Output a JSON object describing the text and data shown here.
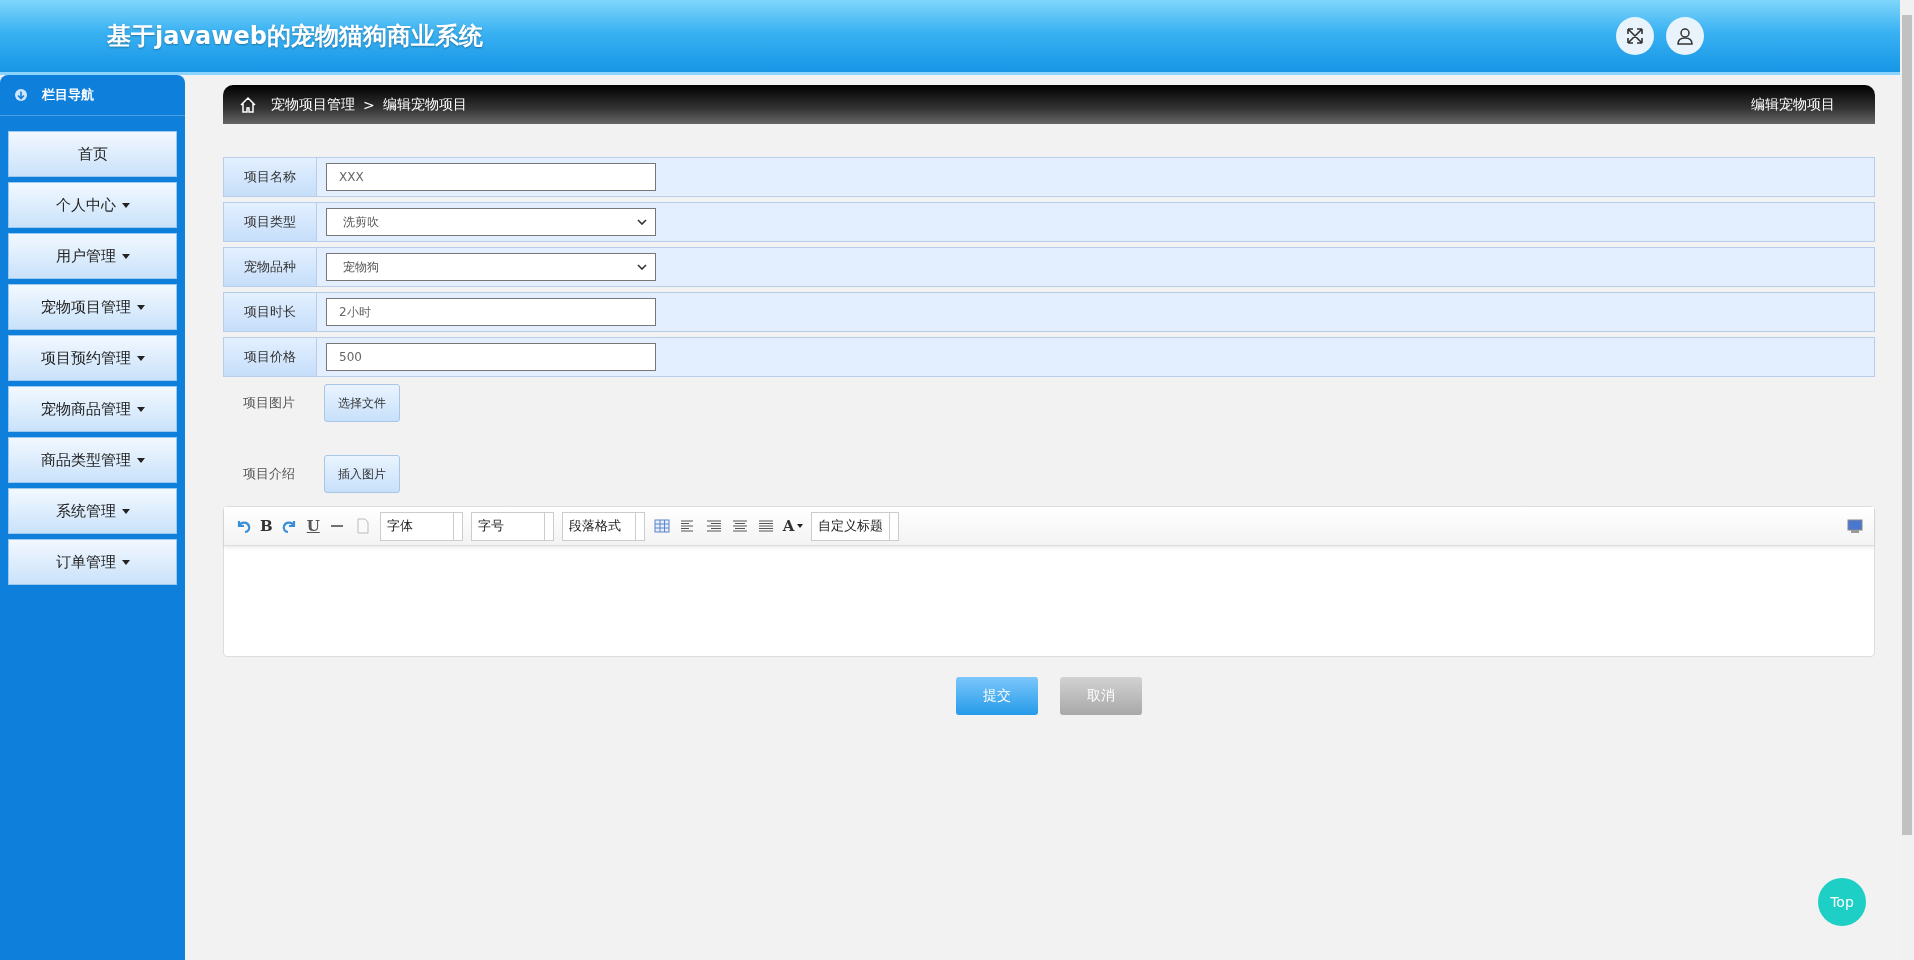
{
  "header": {
    "title": "基于javaweb的宠物猫狗商业系统"
  },
  "sidebar": {
    "title": "栏目导航",
    "items": [
      {
        "label": "首页",
        "has_menu": false
      },
      {
        "label": "个人中心",
        "has_menu": true
      },
      {
        "label": "用户管理",
        "has_menu": true
      },
      {
        "label": "宠物项目管理",
        "has_menu": true
      },
      {
        "label": "项目预约管理",
        "has_menu": true
      },
      {
        "label": "宠物商品管理",
        "has_menu": true
      },
      {
        "label": "商品类型管理",
        "has_menu": true
      },
      {
        "label": "系统管理",
        "has_menu": true
      },
      {
        "label": "订单管理",
        "has_menu": true
      }
    ]
  },
  "breadcrumb": {
    "items": [
      "宠物项目管理",
      "编辑宠物项目"
    ],
    "separator": ">",
    "page_title": "编辑宠物项目"
  },
  "form": {
    "fields": [
      {
        "kind": "text",
        "label": "项目名称",
        "value": "XXX"
      },
      {
        "kind": "select",
        "label": "项目类型",
        "value": "洗剪吹"
      },
      {
        "kind": "select",
        "label": "宠物品种",
        "value": "宠物狗"
      },
      {
        "kind": "text",
        "label": "项目时长",
        "value": "2小时"
      },
      {
        "kind": "text",
        "label": "项目价格",
        "value": "500"
      },
      {
        "kind": "file",
        "label": "项目图片",
        "button": "选择文件"
      },
      {
        "kind": "rich",
        "label": "项目介绍",
        "button": "插入图片"
      }
    ]
  },
  "editor": {
    "toolbar": [
      {
        "kind": "undo"
      },
      {
        "kind": "bold",
        "text": "B"
      },
      {
        "kind": "redo"
      },
      {
        "kind": "underline",
        "text": "U"
      },
      {
        "kind": "hr"
      },
      {
        "kind": "page"
      },
      {
        "kind": "select",
        "text": "字体"
      },
      {
        "kind": "select",
        "text": "字号"
      },
      {
        "kind": "select",
        "text": "段落格式"
      },
      {
        "kind": "table"
      },
      {
        "kind": "align-left"
      },
      {
        "kind": "align-right"
      },
      {
        "kind": "align-center"
      },
      {
        "kind": "justify"
      },
      {
        "kind": "font-color",
        "text": "A"
      },
      {
        "kind": "select",
        "text": "自定义标题"
      },
      {
        "kind": "preview"
      }
    ]
  },
  "buttons": [
    {
      "kind": "primary",
      "label": "提交"
    },
    {
      "kind": "secondary",
      "label": "取消"
    }
  ],
  "back_to_top": {
    "label": "Top"
  }
}
